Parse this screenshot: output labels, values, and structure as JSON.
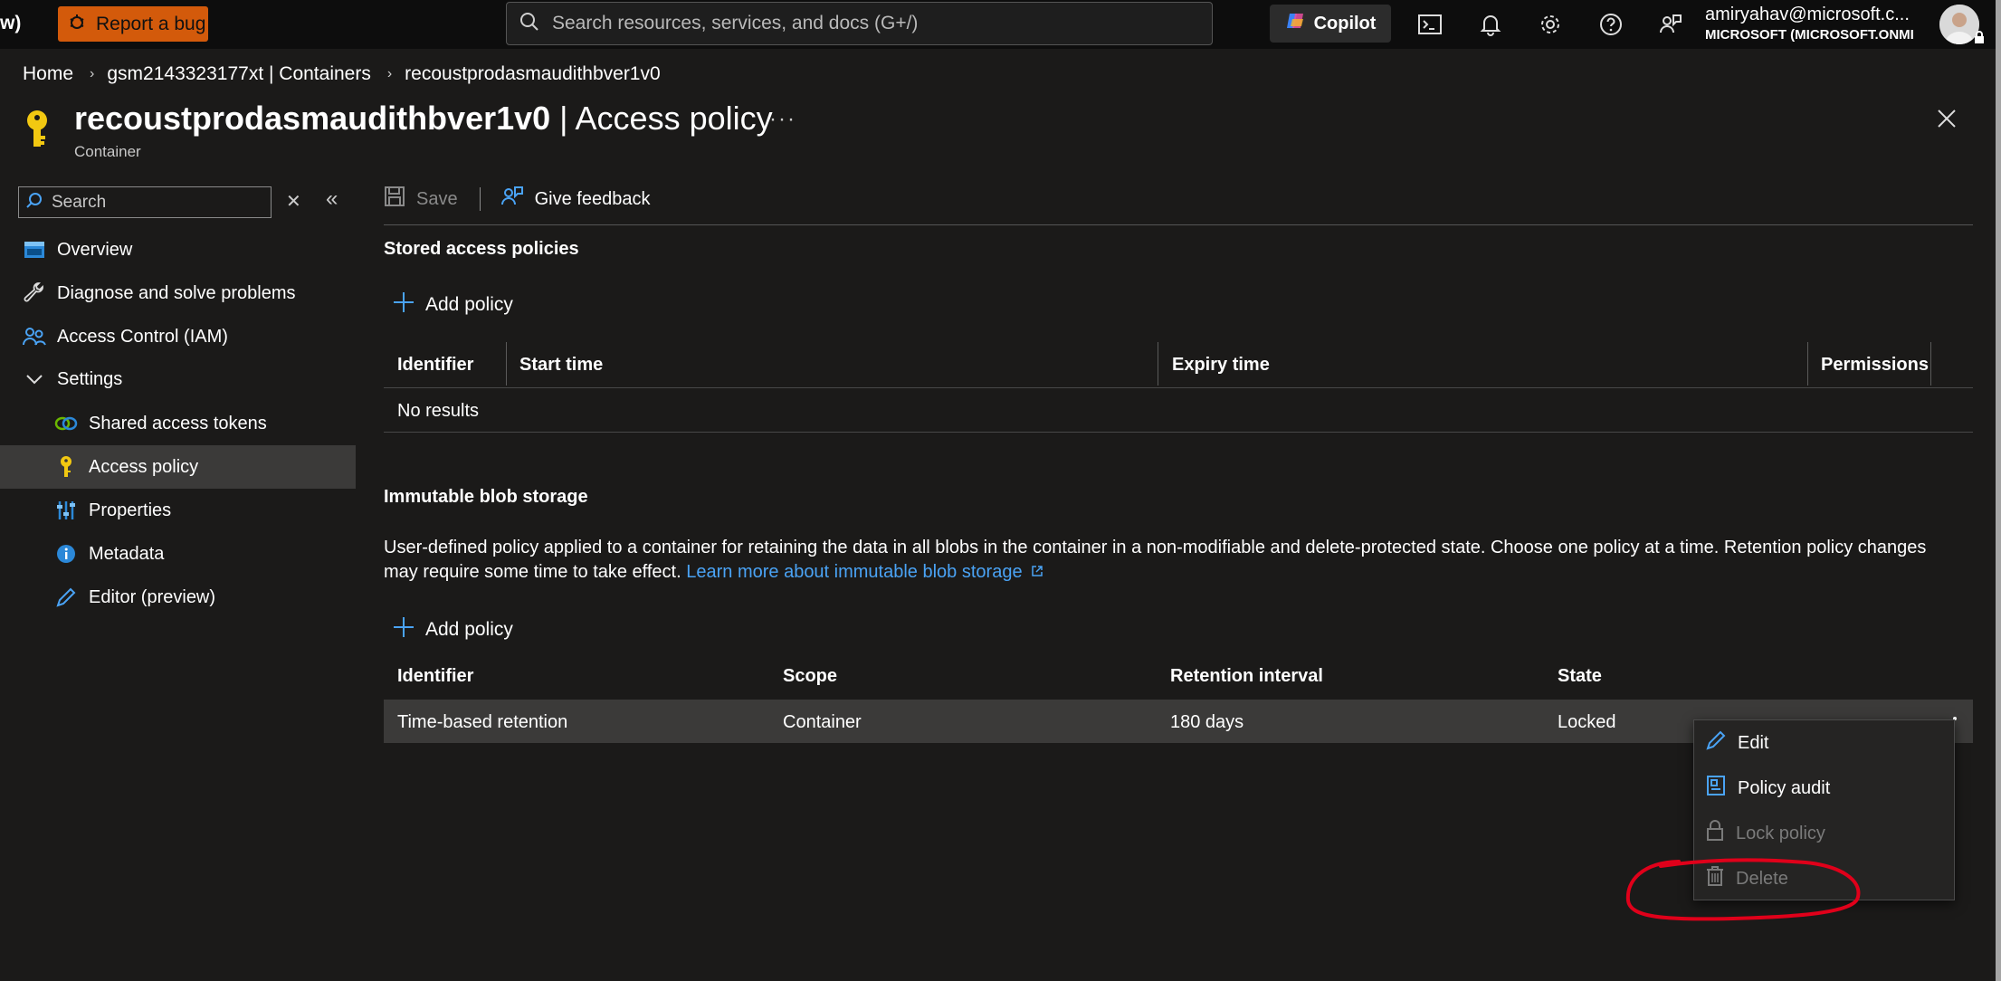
{
  "topbar": {
    "app_fragment": "w)",
    "report_bug_label": "Report a bug",
    "search_placeholder": "Search resources, services, and docs (G+/)",
    "copilot_label": "Copilot",
    "account_email": "amiryahav@microsoft.c...",
    "account_tenant": "MICROSOFT (MICROSOFT.ONMI..."
  },
  "breadcrumb": [
    "Home",
    "gsm2143323177xt | Containers",
    "recoustprodasmaudithbver1v0"
  ],
  "page": {
    "title_bold": "recoustprodasmaudithbver1v0",
    "title_rest": " | Access policy",
    "subtitle": "Container",
    "more_label": "···"
  },
  "sidebar": {
    "search_placeholder": "Search",
    "items": [
      {
        "label": "Overview",
        "icon": "overview-icon"
      },
      {
        "label": "Diagnose and solve problems",
        "icon": "wrench-icon"
      },
      {
        "label": "Access Control (IAM)",
        "icon": "people-icon"
      },
      {
        "label": "Settings",
        "icon": "chevron-down-icon"
      },
      {
        "label": "Shared access tokens",
        "icon": "link-icon"
      },
      {
        "label": "Access policy",
        "icon": "key-icon",
        "active": true
      },
      {
        "label": "Properties",
        "icon": "sliders-icon"
      },
      {
        "label": "Metadata",
        "icon": "info-icon"
      },
      {
        "label": "Editor (preview)",
        "icon": "pencil-icon"
      }
    ]
  },
  "toolbar": {
    "save_label": "Save",
    "feedback_label": "Give feedback"
  },
  "stored_policies": {
    "title": "Stored access policies",
    "add_label": "Add policy",
    "columns": [
      "Identifier",
      "Start time",
      "Expiry time",
      "Permissions"
    ],
    "empty_text": "No results"
  },
  "immutable": {
    "title": "Immutable blob storage",
    "description": "User-defined policy applied to a container for retaining the data in all blobs in the container in a non-modifiable and delete-protected state. Choose one policy at a time. Retention policy changes may require some time to take effect.",
    "learn_more": "Learn more about immutable blob storage",
    "add_label": "Add policy",
    "columns": [
      "Identifier",
      "Scope",
      "Retention interval",
      "State"
    ],
    "rows": [
      {
        "identifier": "Time-based retention",
        "scope": "Container",
        "retention": "180 days",
        "state": "Locked"
      }
    ]
  },
  "context_menu": {
    "items": [
      {
        "label": "Edit",
        "icon": "pencil-icon",
        "enabled": true
      },
      {
        "label": "Policy audit",
        "icon": "audit-icon",
        "enabled": true
      },
      {
        "label": "Lock policy",
        "icon": "lock-icon",
        "enabled": false
      },
      {
        "label": "Delete",
        "icon": "trash-icon",
        "enabled": false
      }
    ]
  },
  "colors": {
    "background": "#1b1a19",
    "topbar": "#0d0d0d",
    "report_bug": "#d35a0b",
    "link": "#4aa3f5",
    "selected_row": "#3b3a39",
    "annotation": "#e0001a"
  }
}
